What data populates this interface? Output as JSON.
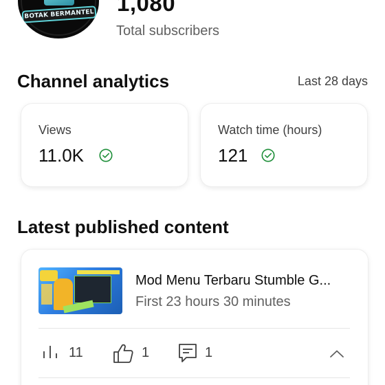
{
  "header": {
    "avatar_text": "BOTAK BERMANTEL",
    "subscriber_count": "1,080",
    "subscriber_label": "Total subscribers"
  },
  "analytics": {
    "title": "Channel analytics",
    "period": "Last 28 days",
    "metrics": [
      {
        "label": "Views",
        "value": "11.0K",
        "icon": "check-circle-icon"
      },
      {
        "label": "Watch time (hours)",
        "value": "121",
        "icon": "check-circle-icon"
      }
    ]
  },
  "latest": {
    "title": "Latest published content",
    "video": {
      "title": "Mod Menu Terbaru Stumble G...",
      "age": "First 23 hours 30 minutes",
      "views": "11",
      "likes": "1",
      "comments": "1"
    }
  },
  "colors": {
    "accent_green": "#1f8f3a",
    "text_primary": "#0f0f0f",
    "text_secondary": "#606060"
  }
}
